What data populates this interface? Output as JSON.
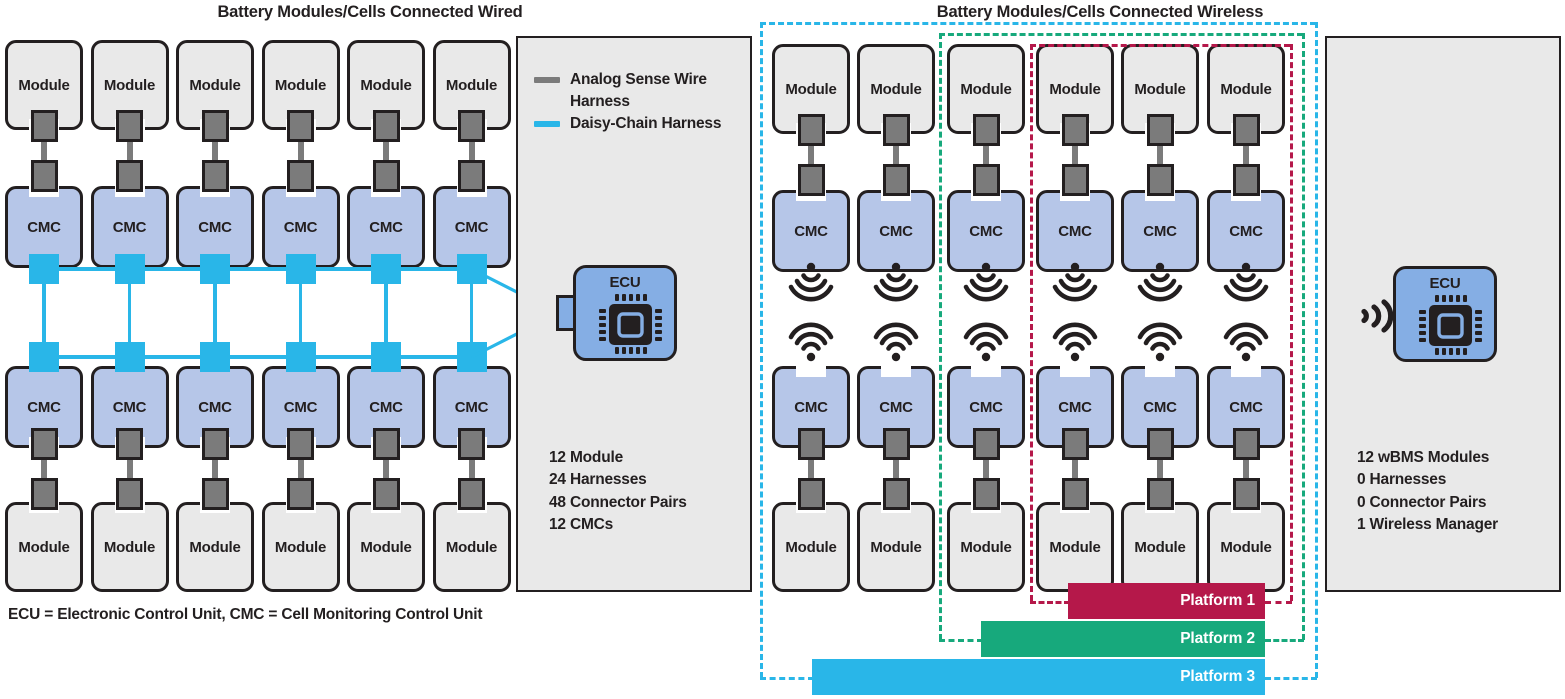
{
  "titles": {
    "wired": "Battery Modules/Cells Connected Wired",
    "wireless": "Battery Modules/Cells Connected Wireless"
  },
  "labels": {
    "module": "Module",
    "cmc": "CMC",
    "ecu": "ECU"
  },
  "legend": {
    "items": [
      {
        "label": "Analog Sense Wire Harness",
        "color": "#7b7b7b",
        "icon": "line-swatch"
      },
      {
        "label": "Daisy-Chain Harness",
        "color": "#29b6e8",
        "icon": "line-swatch"
      }
    ]
  },
  "wired_stats": {
    "lines": [
      "12 Module",
      "24 Harnesses",
      "48 Connector Pairs",
      "12 CMCs"
    ]
  },
  "wireless_stats": {
    "lines": [
      "12 wBMS Modules",
      "0 Harnesses",
      "0 Connector Pairs",
      "1 Wireless Manager"
    ]
  },
  "footnote": "ECU = Electronic Control Unit, CMC = Cell Monitoring Control Unit",
  "platforms": [
    {
      "name": "Platform 1",
      "color": "#b5184a"
    },
    {
      "name": "Platform 2",
      "color": "#17a97c"
    },
    {
      "name": "Platform 3",
      "color": "#29b6e8"
    }
  ],
  "colors": {
    "module_fill": "#e9e9e9",
    "cmc_fill": "#b6c6e8",
    "ecu_fill": "#85aee4",
    "connector_fill": "#7b7b7b",
    "daisy_chain": "#29b6e8",
    "outline": "#231f20",
    "panel_fill": "#e9e9e9",
    "platform1": "#b5184a",
    "platform2": "#17a97c",
    "platform3": "#29b6e8"
  },
  "counts": {
    "wired_columns": 6,
    "wireless_columns": 6,
    "wired_modules_per_column": 2,
    "wireless_modules_per_column": 2
  },
  "icons": {
    "antenna_down": "antenna-signal-down-icon",
    "antenna_up": "wifi-signal-up-icon",
    "antenna_side": "wireless-broadcast-icon",
    "chip": "microchip-icon"
  }
}
